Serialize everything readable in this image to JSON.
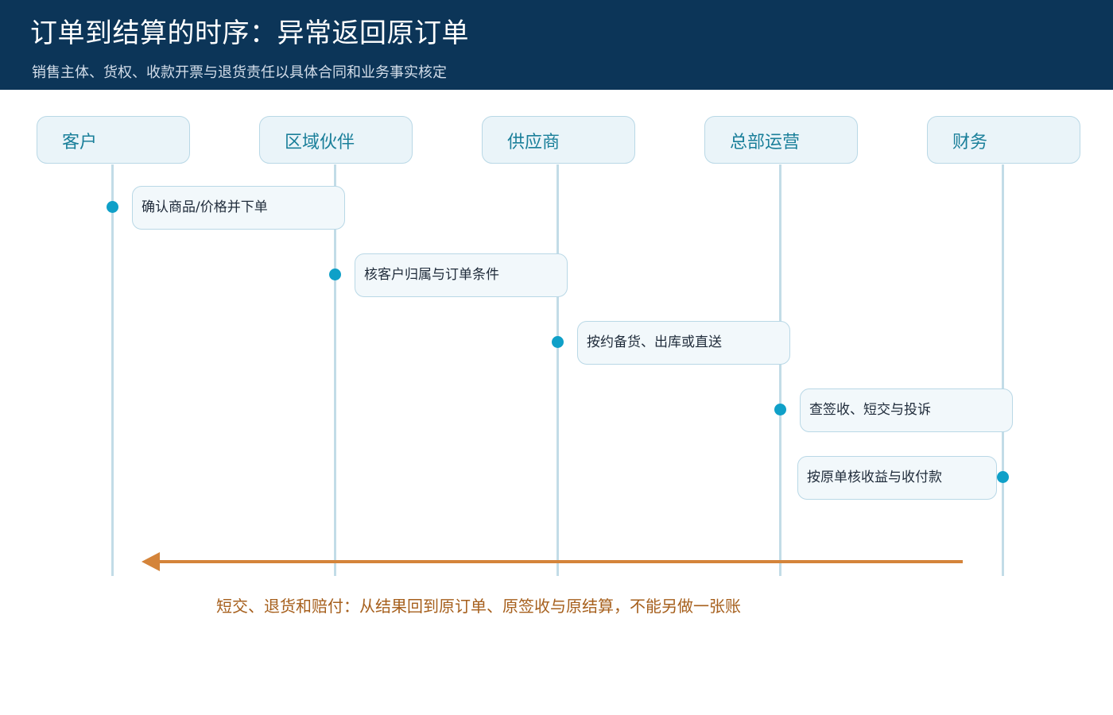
{
  "header": {
    "title": "订单到结算的时序：异常返回原订单",
    "subtitle": "销售主体、货权、收款开票与退货责任以具体合同和业务事实核定"
  },
  "actors": [
    {
      "label": "客户"
    },
    {
      "label": "区域伙伴"
    },
    {
      "label": "供应商"
    },
    {
      "label": "总部运营"
    },
    {
      "label": "财务"
    }
  ],
  "steps": [
    {
      "label": "确认商品/价格并下单"
    },
    {
      "label": "核客户归属与订单条件"
    },
    {
      "label": "按约备货、出库或直送"
    },
    {
      "label": "查签收、短交与投诉"
    },
    {
      "label": "按原单核收益与收付款"
    }
  ],
  "return_flow": {
    "label": "短交、退货和赔付：从结果回到原订单、原签收与原结算，不能另做一张账"
  },
  "colors": {
    "header_bg": "#0c3558",
    "actor_text": "#1a7f9a",
    "dot": "#0fa0c8",
    "lifeline": "#c2dce7",
    "return_arrow": "#d4843a",
    "return_text": "#a65f1c"
  }
}
